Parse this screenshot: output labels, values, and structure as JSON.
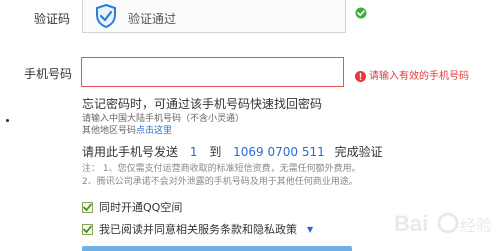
{
  "captcha": {
    "label": "验证码",
    "status": "验证通过",
    "icon": "shield-check-icon",
    "ok_icon": "green-check-icon",
    "colors": {
      "shield": "#2a7fd4",
      "ok": "#3cae3c"
    }
  },
  "phone": {
    "label": "手机号码",
    "value": "",
    "placeholder": "",
    "error": "请输入有效的手机号码",
    "error_icon": "error-circle-icon",
    "colors": {
      "border": "#e55454",
      "error": "#e5393b"
    }
  },
  "tips": {
    "main": "忘记密码时，可通过该手机号码快速找回密码",
    "sub1": "请输入中国大陆手机号码（不含小灵通）",
    "sub2_prefix": "其他地区号码",
    "sub2_link": "点击这里"
  },
  "sms": {
    "prefix": "请用此手机号发送",
    "code": "1",
    "to": "到",
    "number": "1069 0700 511",
    "suffix": "完成验证"
  },
  "notes": {
    "line1": "注：  1、您仅需支付运营商收取的标准短信资费，无需任何额外费用。",
    "line2": "2、腾讯公司承诺不会对外泄露的手机号码及用于其他任何商业用途。"
  },
  "options": [
    {
      "label": "同时开通QQ空间",
      "checked": true
    },
    {
      "label": "我已阅读并同意相关服务条款和隐私政策",
      "checked": true,
      "has_dropdown": true
    }
  ]
}
